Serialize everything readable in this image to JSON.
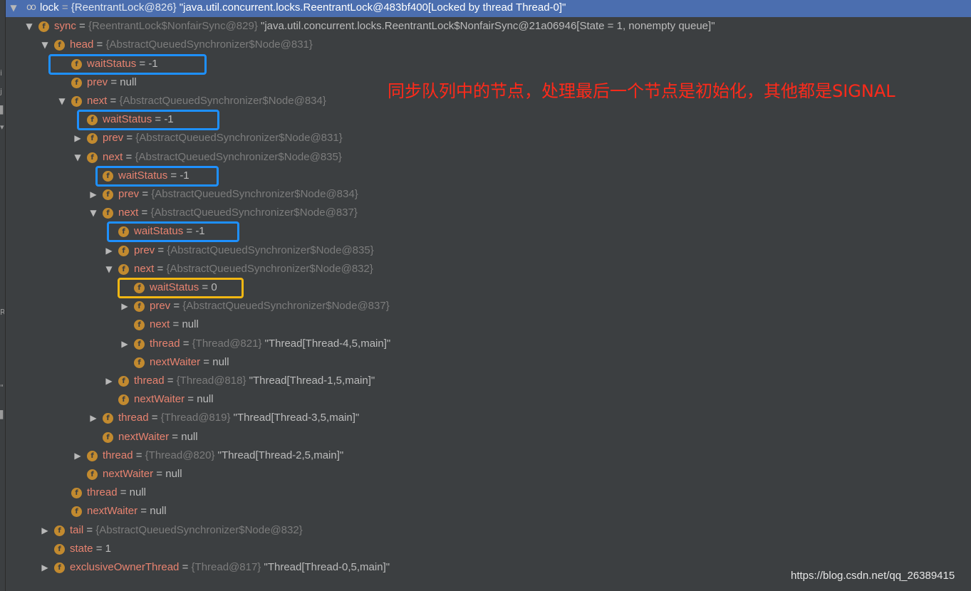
{
  "annotation": "同步队列中的节点，处理最后一个节点是初始化，其他都是SIGNAL",
  "watermark": "https://blog.csdn.net/qq_26389415",
  "colors": {
    "panel_bg": "#3c3f41",
    "selection": "#4b6eaf",
    "field_name": "#e88370",
    "reference": "#7c7c7c",
    "field_icon": "#c28a2f",
    "highlight_blue": "#1e90ff",
    "highlight_yellow": "#f2b713",
    "annotation_red": "#ff2a1a"
  },
  "icons": {
    "expanded": "▼",
    "collapsed": "▶",
    "field": "f",
    "watch": "oo"
  },
  "rows": [
    {
      "name": "lock",
      "eq": " = ",
      "ref": "{ReentrantLock@826}",
      "val": " \"java.util.concurrent.locks.ReentrantLock@483bf400[Locked by thread Thread-0]\""
    },
    {
      "name": "sync",
      "eq": " = ",
      "ref": "{ReentrantLock$NonfairSync@829}",
      "val": " \"java.util.concurrent.locks.ReentrantLock$NonfairSync@21a06946[State = 1, nonempty queue]\""
    },
    {
      "name": "head",
      "eq": " = ",
      "ref": "{AbstractQueuedSynchronizer$Node@831}",
      "val": ""
    },
    {
      "name": "waitStatus",
      "eq": " = ",
      "ref": "",
      "val": "-1"
    },
    {
      "name": "prev",
      "eq": " = ",
      "ref": "",
      "val": "null"
    },
    {
      "name": "next",
      "eq": " = ",
      "ref": "{AbstractQueuedSynchronizer$Node@834}",
      "val": ""
    },
    {
      "name": "waitStatus",
      "eq": " = ",
      "ref": "",
      "val": "-1"
    },
    {
      "name": "prev",
      "eq": " = ",
      "ref": "{AbstractQueuedSynchronizer$Node@831}",
      "val": ""
    },
    {
      "name": "next",
      "eq": " = ",
      "ref": "{AbstractQueuedSynchronizer$Node@835}",
      "val": ""
    },
    {
      "name": "waitStatus",
      "eq": " = ",
      "ref": "",
      "val": "-1"
    },
    {
      "name": "prev",
      "eq": " = ",
      "ref": "{AbstractQueuedSynchronizer$Node@834}",
      "val": ""
    },
    {
      "name": "next",
      "eq": " = ",
      "ref": "{AbstractQueuedSynchronizer$Node@837}",
      "val": ""
    },
    {
      "name": "waitStatus",
      "eq": " = ",
      "ref": "",
      "val": "-1"
    },
    {
      "name": "prev",
      "eq": " = ",
      "ref": "{AbstractQueuedSynchronizer$Node@835}",
      "val": ""
    },
    {
      "name": "next",
      "eq": " = ",
      "ref": "{AbstractQueuedSynchronizer$Node@832}",
      "val": ""
    },
    {
      "name": "waitStatus",
      "eq": " = ",
      "ref": "",
      "val": "0"
    },
    {
      "name": "prev",
      "eq": " = ",
      "ref": "{AbstractQueuedSynchronizer$Node@837}",
      "val": ""
    },
    {
      "name": "next",
      "eq": " = ",
      "ref": "",
      "val": "null"
    },
    {
      "name": "thread",
      "eq": " = ",
      "ref": "{Thread@821}",
      "val": " \"Thread[Thread-4,5,main]\""
    },
    {
      "name": "nextWaiter",
      "eq": " = ",
      "ref": "",
      "val": "null"
    },
    {
      "name": "thread",
      "eq": " = ",
      "ref": "{Thread@818}",
      "val": " \"Thread[Thread-1,5,main]\""
    },
    {
      "name": "nextWaiter",
      "eq": " = ",
      "ref": "",
      "val": "null"
    },
    {
      "name": "thread",
      "eq": " = ",
      "ref": "{Thread@819}",
      "val": " \"Thread[Thread-3,5,main]\""
    },
    {
      "name": "nextWaiter",
      "eq": " = ",
      "ref": "",
      "val": "null"
    },
    {
      "name": "thread",
      "eq": " = ",
      "ref": "{Thread@820}",
      "val": " \"Thread[Thread-2,5,main]\""
    },
    {
      "name": "nextWaiter",
      "eq": " = ",
      "ref": "",
      "val": "null"
    },
    {
      "name": "thread",
      "eq": " = ",
      "ref": "",
      "val": "null"
    },
    {
      "name": "nextWaiter",
      "eq": " = ",
      "ref": "",
      "val": "null"
    },
    {
      "name": "tail",
      "eq": " = ",
      "ref": "{AbstractQueuedSynchronizer$Node@832}",
      "val": ""
    },
    {
      "name": "state",
      "eq": " = ",
      "ref": "",
      "val": "1"
    },
    {
      "name": "exclusiveOwnerThread",
      "eq": " = ",
      "ref": "{Thread@817}",
      "val": " \"Thread[Thread-0,5,main]\""
    }
  ]
}
